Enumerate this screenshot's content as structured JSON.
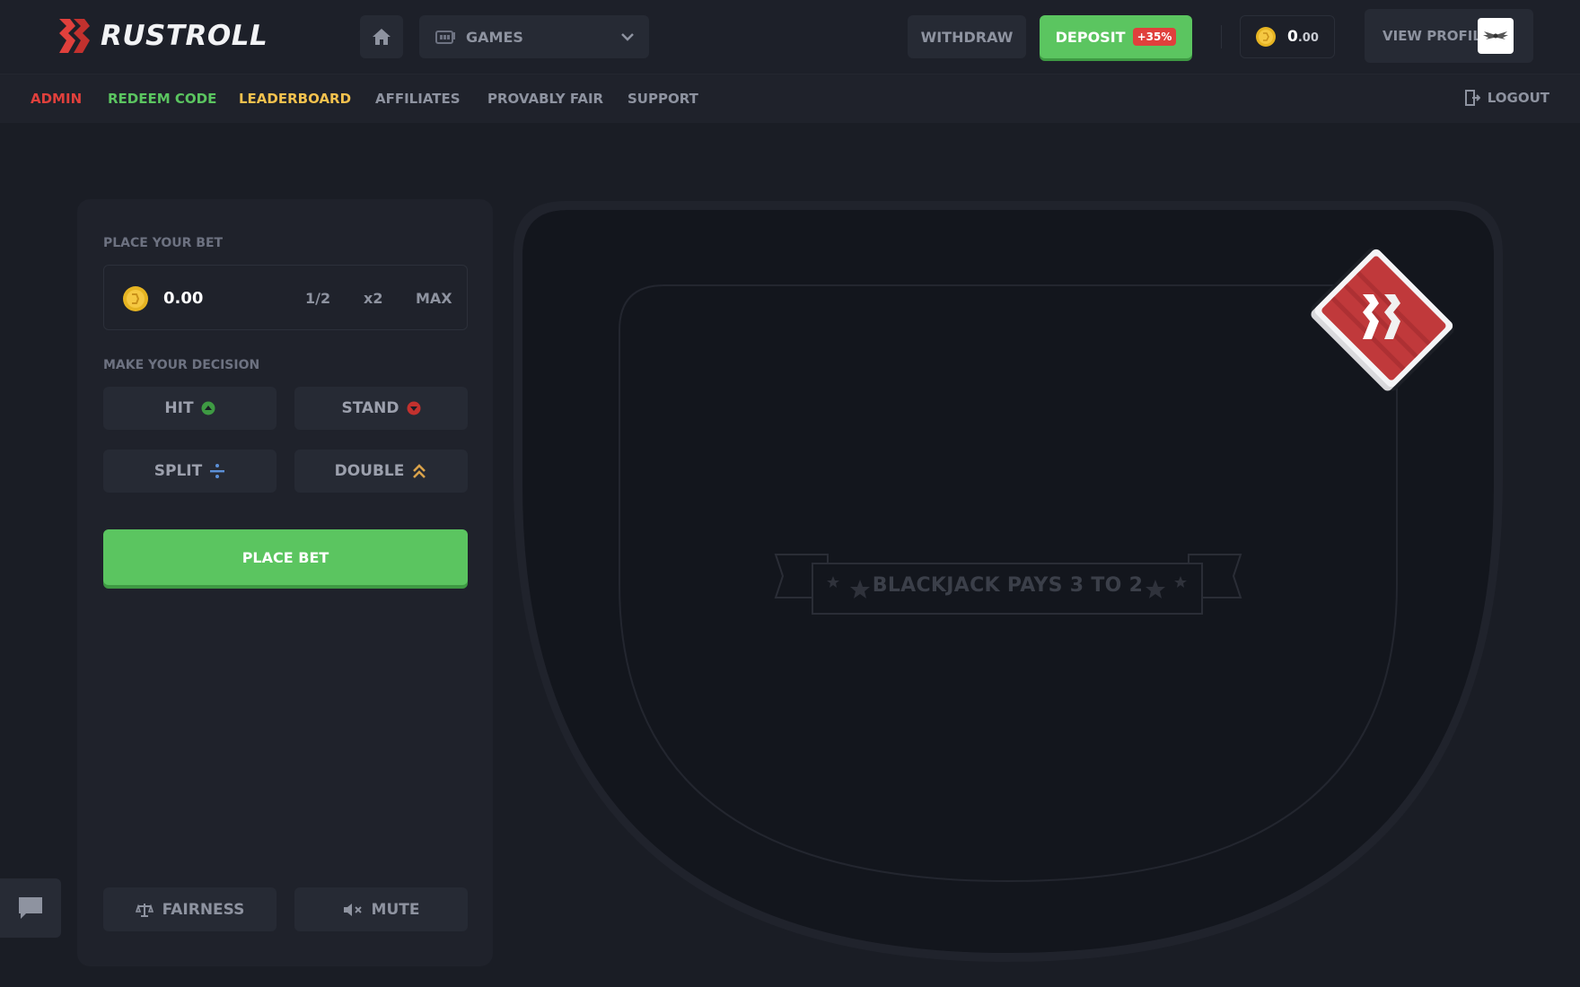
{
  "brand": {
    "name": "RUSTROLL",
    "accent": "#e0403c"
  },
  "header": {
    "home_icon": "home-icon",
    "games_label": "GAMES",
    "withdraw_label": "WITHDRAW",
    "deposit_label": "DEPOSIT",
    "deposit_badge": "+35%",
    "balance_int": "0",
    "balance_dec": ".00",
    "profile_label": "VIEW PROFILE"
  },
  "nav": {
    "items": [
      {
        "label": "ADMIN",
        "color": "#e0403c"
      },
      {
        "label": "REDEEM CODE",
        "color": "#5bc560"
      },
      {
        "label": "LEADERBOARD",
        "color": "#f2c14e"
      },
      {
        "label": "AFFILIATES",
        "color": "#8e93a0"
      },
      {
        "label": "PROVABLY FAIR",
        "color": "#8e93a0"
      },
      {
        "label": "SUPPORT",
        "color": "#8e93a0"
      }
    ],
    "logout_label": "LOGOUT"
  },
  "panel": {
    "place_bet_heading": "PLACE YOUR BET",
    "bet_value": "0.00",
    "half_label": "1/2",
    "double_label": "x2",
    "max_label": "MAX",
    "decision_heading": "MAKE YOUR DECISION",
    "hit_label": "HIT",
    "stand_label": "STAND",
    "split_label": "SPLIT",
    "double_down_label": "DOUBLE",
    "place_bet_button": "PLACE BET",
    "fairness_label": "FAIRNESS",
    "mute_label": "MUTE"
  },
  "table": {
    "banner": "BLACKJACK PAYS 3 TO 2"
  },
  "colors": {
    "success": "#5bc560",
    "danger": "#e0403c",
    "warning": "#f2c14e",
    "split": "#5b8fd6",
    "double": "#d9a24a"
  }
}
